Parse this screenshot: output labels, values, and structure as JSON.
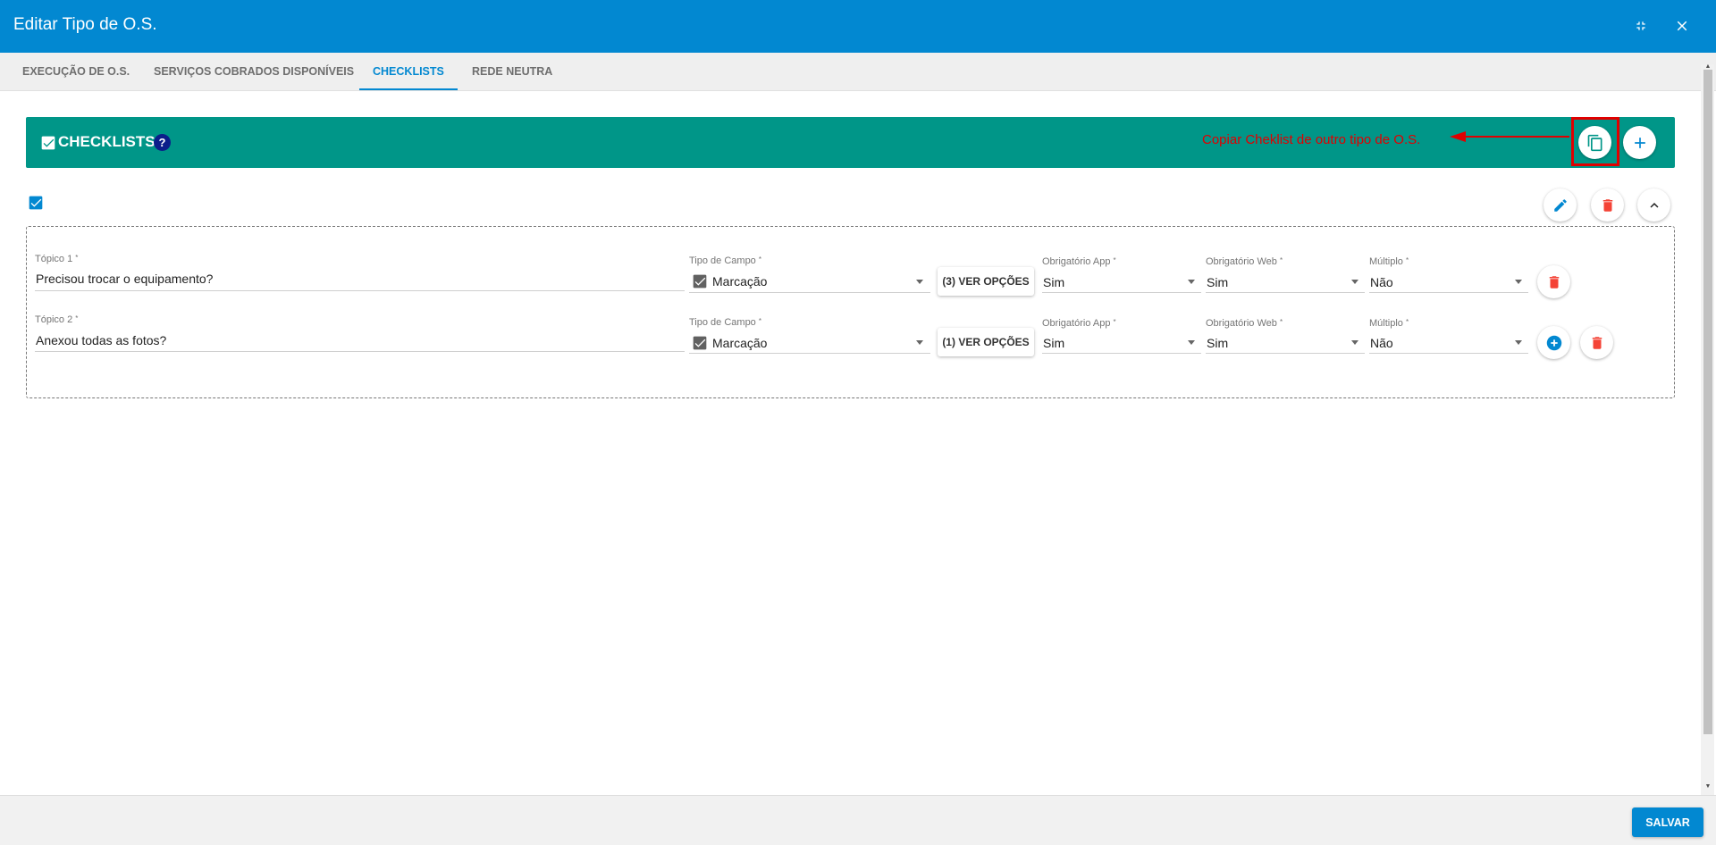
{
  "window": {
    "title": "Editar Tipo de O.S."
  },
  "tabs": [
    {
      "label": "EXECUÇÃO DE O.S.",
      "active": false
    },
    {
      "label": "SERVIÇOS COBRADOS DISPONÍVEIS",
      "active": false
    },
    {
      "label": "CHECKLISTS",
      "active": true
    },
    {
      "label": "REDE NEUTRA",
      "active": false
    }
  ],
  "checklists": {
    "title": "CHECKLISTS",
    "help": "?",
    "annotation": "Copiar Cheklist de outro tipo de O.S."
  },
  "rows": [
    {
      "topic_label": "Tópico 1",
      "topic_value": "Precisou trocar o equipamento?",
      "type_label": "Tipo de Campo",
      "type_value": "Marcação",
      "options_button": "(3) VER OPÇÕES",
      "app_label": "Obrigatório App",
      "app_value": "Sim",
      "web_label": "Obrigatório Web",
      "web_value": "Sim",
      "multi_label": "Múltiplo",
      "multi_value": "Não"
    },
    {
      "topic_label": "Tópico 2",
      "topic_value": "Anexou todas as fotos?",
      "type_label": "Tipo de Campo",
      "type_value": "Marcação",
      "options_button": "(1) VER OPÇÕES",
      "app_label": "Obrigatório App",
      "app_value": "Sim",
      "web_label": "Obrigatório Web",
      "web_value": "Sim",
      "multi_label": "Múltiplo",
      "multi_value": "Não"
    }
  ],
  "required_mark": "*",
  "footer": {
    "save_label": "SALVAR"
  },
  "colors": {
    "primary": "#0288d1",
    "teal": "#009688",
    "danger": "#f44336",
    "annotation": "#e00000"
  },
  "icons": [
    "minimize-icon",
    "close-icon",
    "copy-icon",
    "plus-icon",
    "edit-icon",
    "trash-icon",
    "chevron-up-icon",
    "checkbox-icon",
    "help-icon",
    "add-circle-icon"
  ]
}
